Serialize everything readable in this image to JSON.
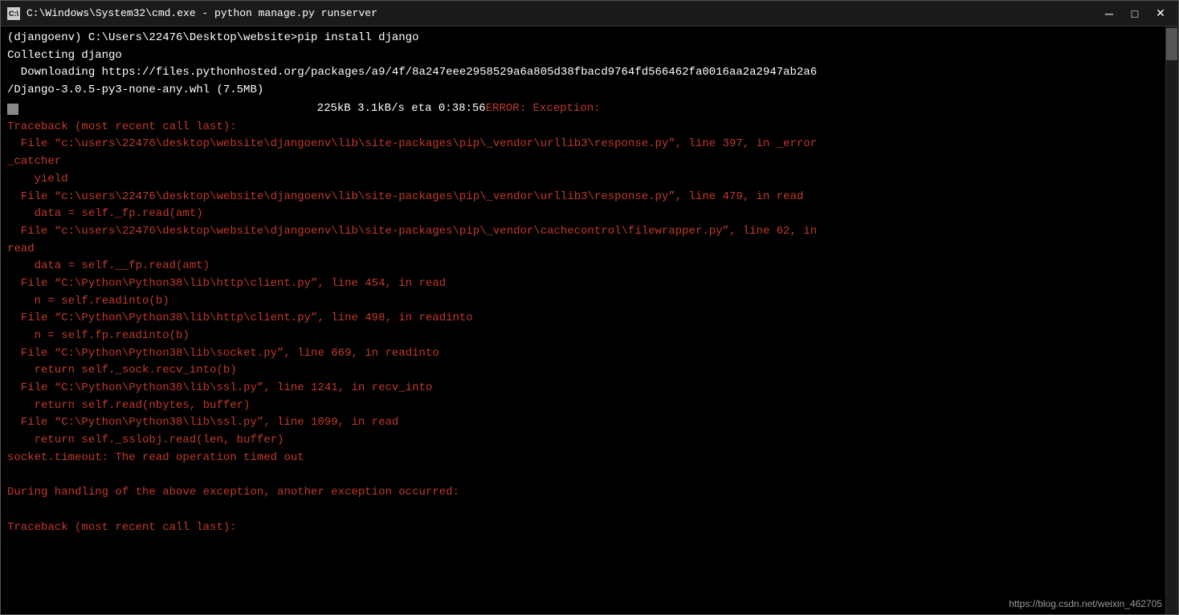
{
  "titleBar": {
    "icon": "C:\\",
    "title": "C:\\Windows\\System32\\cmd.exe - python  manage.py runserver",
    "minimize": "─",
    "maximize": "□",
    "close": "✕"
  },
  "terminal": {
    "lines": [
      {
        "id": "l1",
        "text": "(djangoenv) C:\\Users\\22476\\Desktop\\website>pip install django",
        "color": "white"
      },
      {
        "id": "l2",
        "text": "Collecting django",
        "color": "white"
      },
      {
        "id": "l3",
        "text": "  Downloading https://files.pythonhosted.org/packages/a9/4f/8a247eee2958529a6a805d38fbacd9764fd566462fa0016aa2a2947ab2a6",
        "color": "white"
      },
      {
        "id": "l4",
        "text": "/Django-3.0.5-py3-none-any.whl (7.5MB)",
        "color": "white"
      },
      {
        "id": "l5-progress",
        "type": "progress",
        "barWidth": 30,
        "text": "  225kB 3.1kB/s eta 0:38:56",
        "errorText": "ERROR: Exception:"
      },
      {
        "id": "l6",
        "text": "Traceback (most recent call last):",
        "color": "red"
      },
      {
        "id": "l7",
        "text": "  File “c:\\users\\22476\\desktop\\website\\djangoenv\\lib\\site-packages\\pip\\_vendor\\urllib3\\response.py”, line 397, in _error",
        "color": "red"
      },
      {
        "id": "l8",
        "text": "_catcher",
        "color": "red"
      },
      {
        "id": "l9",
        "text": "    yield",
        "color": "red"
      },
      {
        "id": "l10",
        "text": "  File “c:\\users\\22476\\desktop\\website\\djangoenv\\lib\\site-packages\\pip\\_vendor\\urllib3\\response.py”, line 479, in read",
        "color": "red"
      },
      {
        "id": "l11",
        "text": "    data = self._fp.read(amt)",
        "color": "red"
      },
      {
        "id": "l12",
        "text": "  File “c:\\users\\22476\\desktop\\website\\djangoenv\\lib\\site-packages\\pip\\_vendor\\cachecontrol\\filewrapper.py”, line 62, in",
        "color": "red"
      },
      {
        "id": "l13",
        "text": "read",
        "color": "red"
      },
      {
        "id": "l14",
        "text": "    data = self.__fp.read(amt)",
        "color": "red"
      },
      {
        "id": "l15",
        "text": "  File “C:\\Python\\Python38\\lib\\http\\client.py”, line 454, in read",
        "color": "red"
      },
      {
        "id": "l16",
        "text": "    n = self.readinto(b)",
        "color": "red"
      },
      {
        "id": "l17",
        "text": "  File “C:\\Python\\Python38\\lib\\http\\client.py”, line 498, in readinto",
        "color": "red"
      },
      {
        "id": "l18",
        "text": "    n = self.fp.readinto(b)",
        "color": "red"
      },
      {
        "id": "l19",
        "text": "  File “C:\\Python\\Python38\\lib\\socket.py”, line 669, in readinto",
        "color": "red"
      },
      {
        "id": "l20",
        "text": "    return self._sock.recv_into(b)",
        "color": "red"
      },
      {
        "id": "l21",
        "text": "  File “C:\\Python\\Python38\\lib\\ssl.py”, line 1241, in recv_into",
        "color": "red"
      },
      {
        "id": "l22",
        "text": "    return self.read(nbytes, buffer)",
        "color": "red"
      },
      {
        "id": "l23",
        "text": "  File “C:\\Python\\Python38\\lib\\ssl.py”, line 1099, in read",
        "color": "red"
      },
      {
        "id": "l24",
        "text": "    return self._sslobj.read(len, buffer)",
        "color": "red"
      },
      {
        "id": "l25",
        "text": "socket.timeout: The read operation timed out",
        "color": "red"
      },
      {
        "id": "l26",
        "text": "",
        "color": "white"
      },
      {
        "id": "l27",
        "text": "During handling of the above exception, another exception occurred:",
        "color": "red"
      },
      {
        "id": "l28",
        "text": "",
        "color": "white"
      },
      {
        "id": "l29",
        "text": "Traceback (most recent call last):",
        "color": "red"
      }
    ],
    "watermark": "https://blog.csdn.net/weixin_462705"
  }
}
